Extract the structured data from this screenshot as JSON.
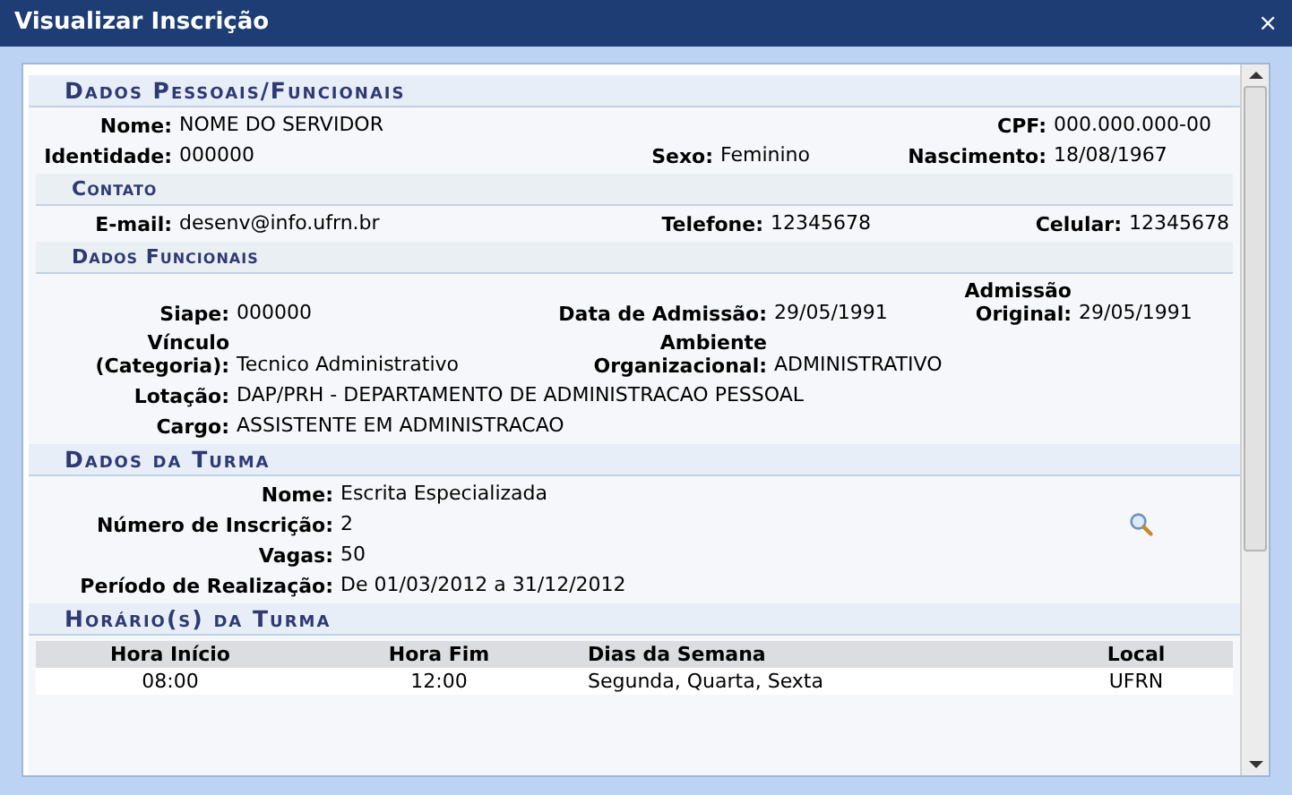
{
  "window": {
    "title": "Visualizar Inscrição",
    "close": "×"
  },
  "sections": [
    {
      "title": "Dados Pessoais/Funcionais",
      "kind": "main",
      "rows": [
        [
          {
            "label": "Nome:",
            "value": "NOME DO SERVIDOR"
          },
          "",
          {
            "label": "CPF:",
            "value": "000.000.000-00"
          }
        ],
        [
          {
            "label": "Identidade:",
            "value": "000000"
          },
          {
            "label": "Sexo:",
            "value": "Feminino"
          },
          {
            "label": "Nascimento:",
            "value": "18/08/1967"
          }
        ]
      ]
    },
    {
      "title": "Contato",
      "kind": "sub",
      "rows": [
        [
          {
            "label": "E-mail:",
            "value": "desenv@info.ufrn.br"
          },
          {
            "label": "Telefone:",
            "value": "12345678"
          },
          {
            "label": "Celular:",
            "value": "12345678"
          }
        ]
      ]
    },
    {
      "title": "Dados Funcionais",
      "kind": "sub",
      "rows": [
        [
          {
            "label": "Siape:",
            "value": "000000"
          },
          {
            "label": "Data de Admissão:",
            "value": "29/05/1991"
          },
          {
            "label": "Admissão Original:",
            "value": "29/05/1991"
          }
        ],
        [
          {
            "label": "Vínculo (Categoria):",
            "value": "Tecnico Administrativo"
          },
          {
            "label": "Ambiente Organizacional:",
            "value": "ADMINISTRATIVO"
          }
        ],
        [
          {
            "label": "Lotação:",
            "value": "DAP/PRH - DEPARTAMENTO DE ADMINISTRACAO PESSOAL"
          }
        ],
        [
          {
            "label": "Cargo:",
            "value": "ASSISTENTE EM ADMINISTRACAO"
          }
        ]
      ]
    },
    {
      "title": "Dados da Turma",
      "kind": "main",
      "rows": [
        [
          {
            "label": "Nome:",
            "value": "Escrita Especializada"
          }
        ],
        [
          {
            "label": "Número de Inscrição:",
            "value": "2"
          }
        ],
        [
          {
            "label": "Vagas:",
            "value": "50"
          }
        ],
        [
          {
            "label": "Período de Realização:",
            "value": "De 01/03/2012 a 31/12/2012"
          }
        ]
      ]
    },
    {
      "title": "Horário(s) da Turma",
      "kind": "main",
      "table": {
        "columns": [
          "Hora Início",
          "Hora Fim",
          "Dias da Semana",
          "Local"
        ],
        "rows": [
          [
            "08:00",
            "12:00",
            "Segunda, Quarta, Sexta",
            "UFRN"
          ]
        ]
      }
    }
  ]
}
